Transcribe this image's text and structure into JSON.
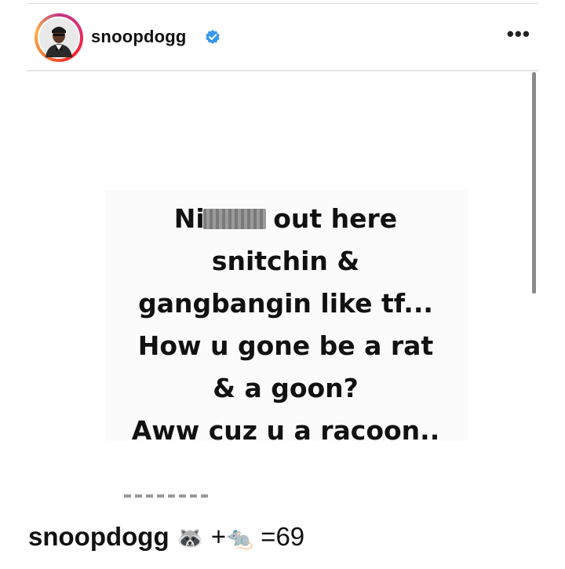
{
  "header": {
    "username": "snoopdogg",
    "verified": true,
    "more_label": "•••"
  },
  "post": {
    "story_lines": [
      "Ni",
      " out here",
      "snitchin &",
      "gangbangin like tf...",
      "How u gone be a rat",
      "& a goon?",
      "Aww cuz u a racoon.."
    ],
    "censored_word": "censored"
  },
  "caption": {
    "username": "snoopdogg",
    "raccoon_emoji": "🦝",
    "plus": "+",
    "rat_emoji": "🐀",
    "suffix": "=69"
  },
  "colors": {
    "verified_badge": "#3897f0",
    "text": "#111111",
    "divider": "#e4e4e4"
  }
}
